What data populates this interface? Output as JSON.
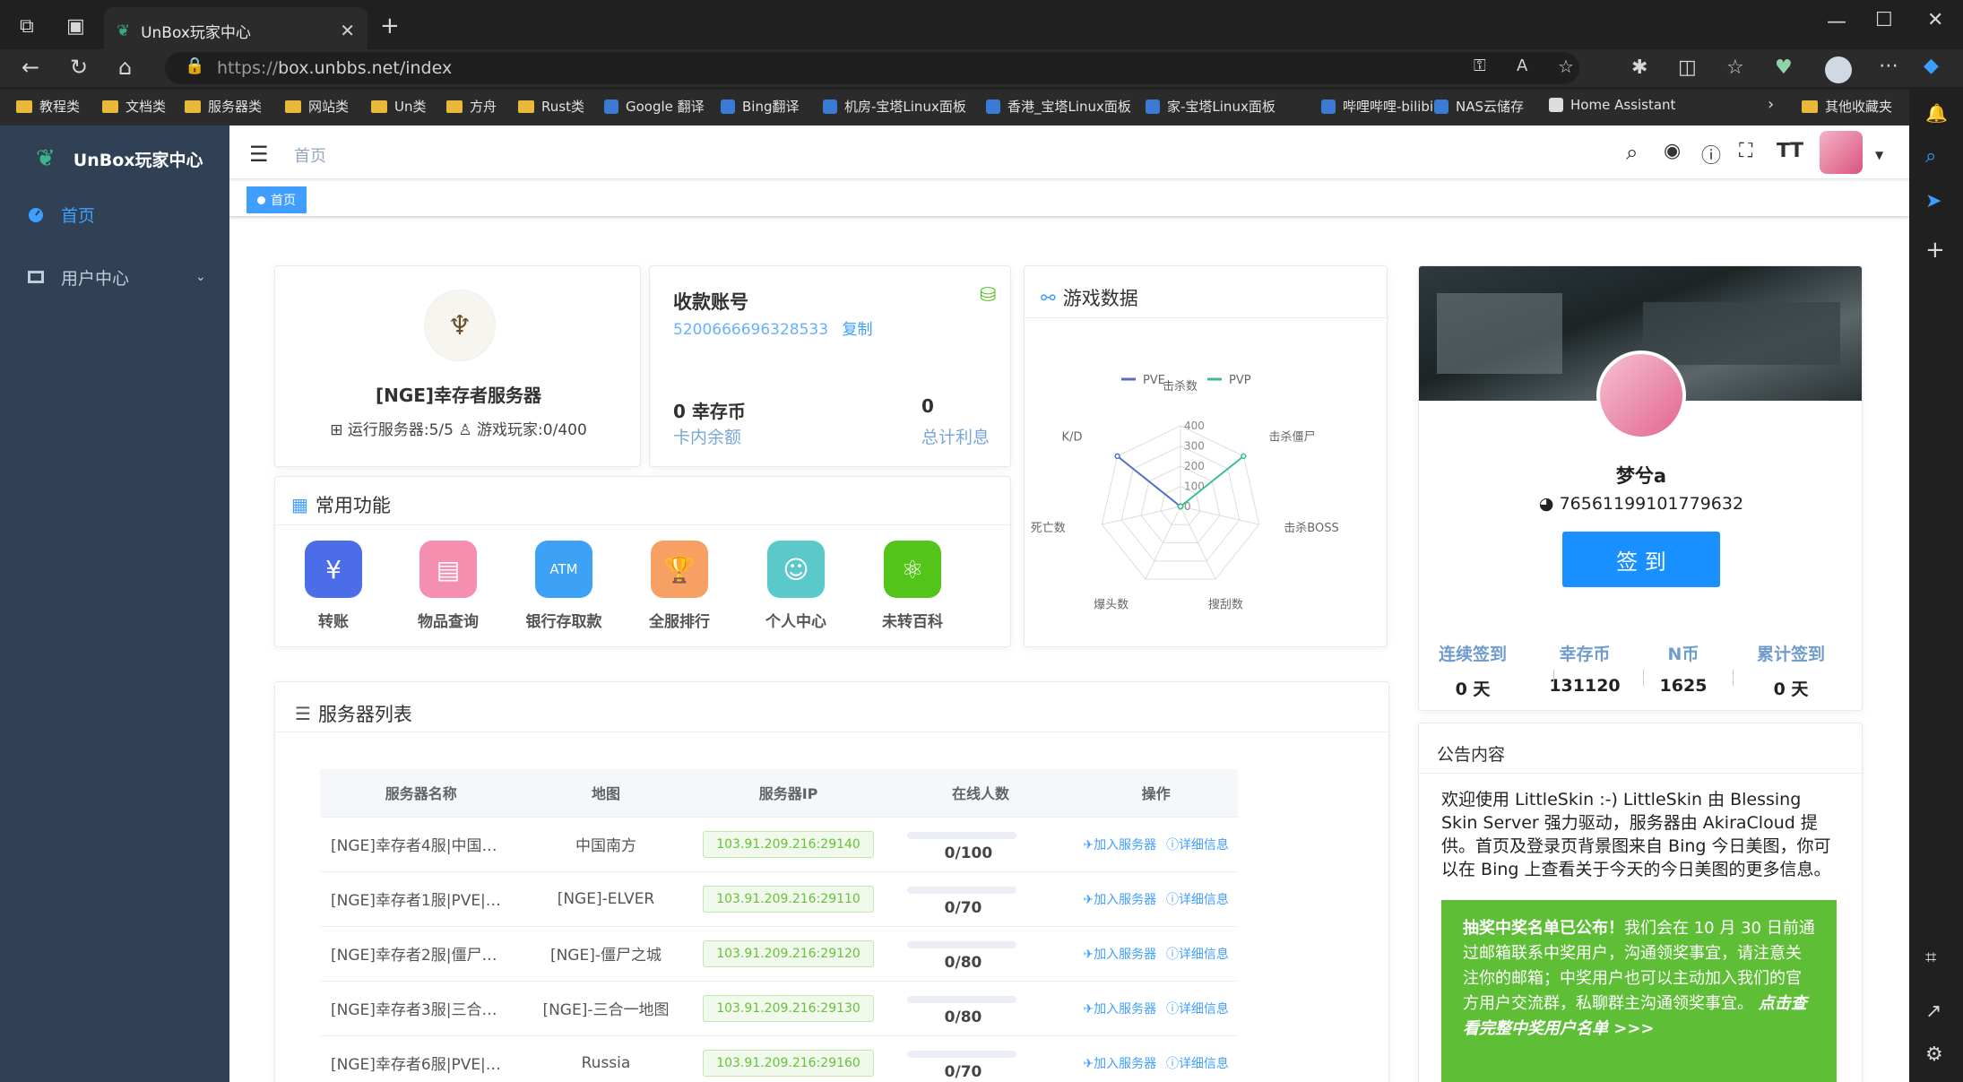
{
  "browser": {
    "tab_title": "UnBox玩家中心",
    "url_scheme": "https://",
    "url_rest": "box.unbbs.net/index",
    "bookmarks": [
      "教程类",
      "文档类",
      "服务器类",
      "网站类",
      "Un类",
      "方舟",
      "Rust类",
      "Google 翻译",
      "Bing翻译",
      "机房-宝塔Linux面板",
      "香港_宝塔Linux面板",
      "家-宝塔Linux面板",
      "哔哩哔哩-bilibili",
      "NAS云储存",
      "Home Assistant",
      "其他收藏夹"
    ]
  },
  "sidebar": {
    "logo": "UnBox玩家中心",
    "items": [
      {
        "label": "首页"
      },
      {
        "label": "用户中心"
      }
    ]
  },
  "header": {
    "breadcrumb": "首页",
    "tag": "首页"
  },
  "server_card": {
    "name": "[NGE]幸存者服务器",
    "stats": "运行服务器:5/5",
    "players": "游戏玩家:0/400"
  },
  "account_card": {
    "title": "收款账号",
    "account_no": "5200666696328533",
    "copy": "复制",
    "coin_value": "0 幸存币",
    "coin_label": "卡内余额",
    "interest_value": "0",
    "interest_label": "总计利息"
  },
  "quick": {
    "title": "常用功能",
    "items": [
      {
        "label": "转账",
        "color": "#4b6ee8",
        "icon": "¥"
      },
      {
        "label": "物品查询",
        "color": "#f58fb0",
        "icon": "▤"
      },
      {
        "label": "银行存取款",
        "color": "#3da2f5",
        "icon": "ATM"
      },
      {
        "label": "全服排行",
        "color": "#f7a064",
        "icon": "🏆"
      },
      {
        "label": "个人中心",
        "color": "#5bc8c9",
        "icon": "☺"
      },
      {
        "label": "未转百科",
        "color": "#52c41a",
        "icon": "⚛"
      }
    ]
  },
  "game_data": {
    "title": "游戏数据",
    "legend": [
      "PVE",
      "PVP"
    ],
    "axes": [
      "击杀数",
      "击杀僵尸",
      "击杀BOSS",
      "搜刮数",
      "爆头数",
      "死亡数",
      "K/D"
    ],
    "ticks": [
      "400",
      "300",
      "200",
      "100",
      "0"
    ]
  },
  "chart_data": {
    "type": "radar",
    "categories": [
      "击杀数",
      "击杀僵尸",
      "击杀BOSS",
      "搜刮数",
      "爆头数",
      "死亡数",
      "K/D"
    ],
    "series": [
      {
        "name": "PVE",
        "values": [
          0,
          0,
          0,
          0,
          0,
          0,
          400
        ],
        "color": "#5470c6"
      },
      {
        "name": "PVP",
        "values": [
          0,
          400,
          0,
          0,
          0,
          0,
          0
        ],
        "color": "#37c08b"
      }
    ],
    "ticks": [
      0,
      100,
      200,
      300,
      400
    ],
    "max": 400,
    "legend_position": "top"
  },
  "server_list": {
    "title": "服务器列表",
    "columns": [
      "服务器名称",
      "地图",
      "服务器IP",
      "在线人数",
      "操作"
    ],
    "join": "加入服务器",
    "detail": "详细信息",
    "rows": [
      {
        "name": "[NGE]幸存者4服|中国南…",
        "map": "中国南方",
        "ip": "103.91.209.216:29140",
        "online": "0/100"
      },
      {
        "name": "[NGE]幸存者1服|PVE|El…",
        "map": "[NGE]-ELVER",
        "ip": "103.91.209.216:29110",
        "online": "0/70"
      },
      {
        "name": "[NGE]幸存者2服|僵尸之…",
        "map": "[NGE]-僵尸之城",
        "ip": "103.91.209.216:29120",
        "online": "0/80"
      },
      {
        "name": "[NGE]幸存者3服|三合一…",
        "map": "[NGE]-三合一地图",
        "ip": "103.91.209.216:29130",
        "online": "0/80"
      },
      {
        "name": "[NGE]幸存者6服|PVE|…",
        "map": "Russia",
        "ip": "103.91.209.216:29160",
        "online": "0/70"
      }
    ]
  },
  "profile": {
    "name": "梦兮a",
    "steam_id": "76561199101779632",
    "sign_button": "签 到",
    "stats": [
      {
        "label": "连续签到",
        "value": "0 天"
      },
      {
        "label": "幸存币",
        "value": "131120"
      },
      {
        "label": "N币",
        "value": "1625"
      },
      {
        "label": "累计签到",
        "value": "0 天"
      }
    ]
  },
  "notice": {
    "title": "公告内容",
    "body": "欢迎使用 LittleSkin :-) LittleSkin 由 Blessing Skin Server 强力驱动，服务器由 AkiraCloud 提供。首页及登录页背景图来自 Bing 今日美图，你可以在 Bing 上查看关于今天的今日美图的更多信息。",
    "box_bold": "抽奖中奖名单已公布！",
    "box_text": "我们会在 10 月 30 日前通过邮箱联系中奖用户，沟通领奖事宜，请注意关注你的邮箱；中奖用户也可以主动加入我们的官方用户交流群，私聊群主沟通领奖事宜。",
    "box_link": "点击查看完整中奖用户名单 >>>"
  }
}
